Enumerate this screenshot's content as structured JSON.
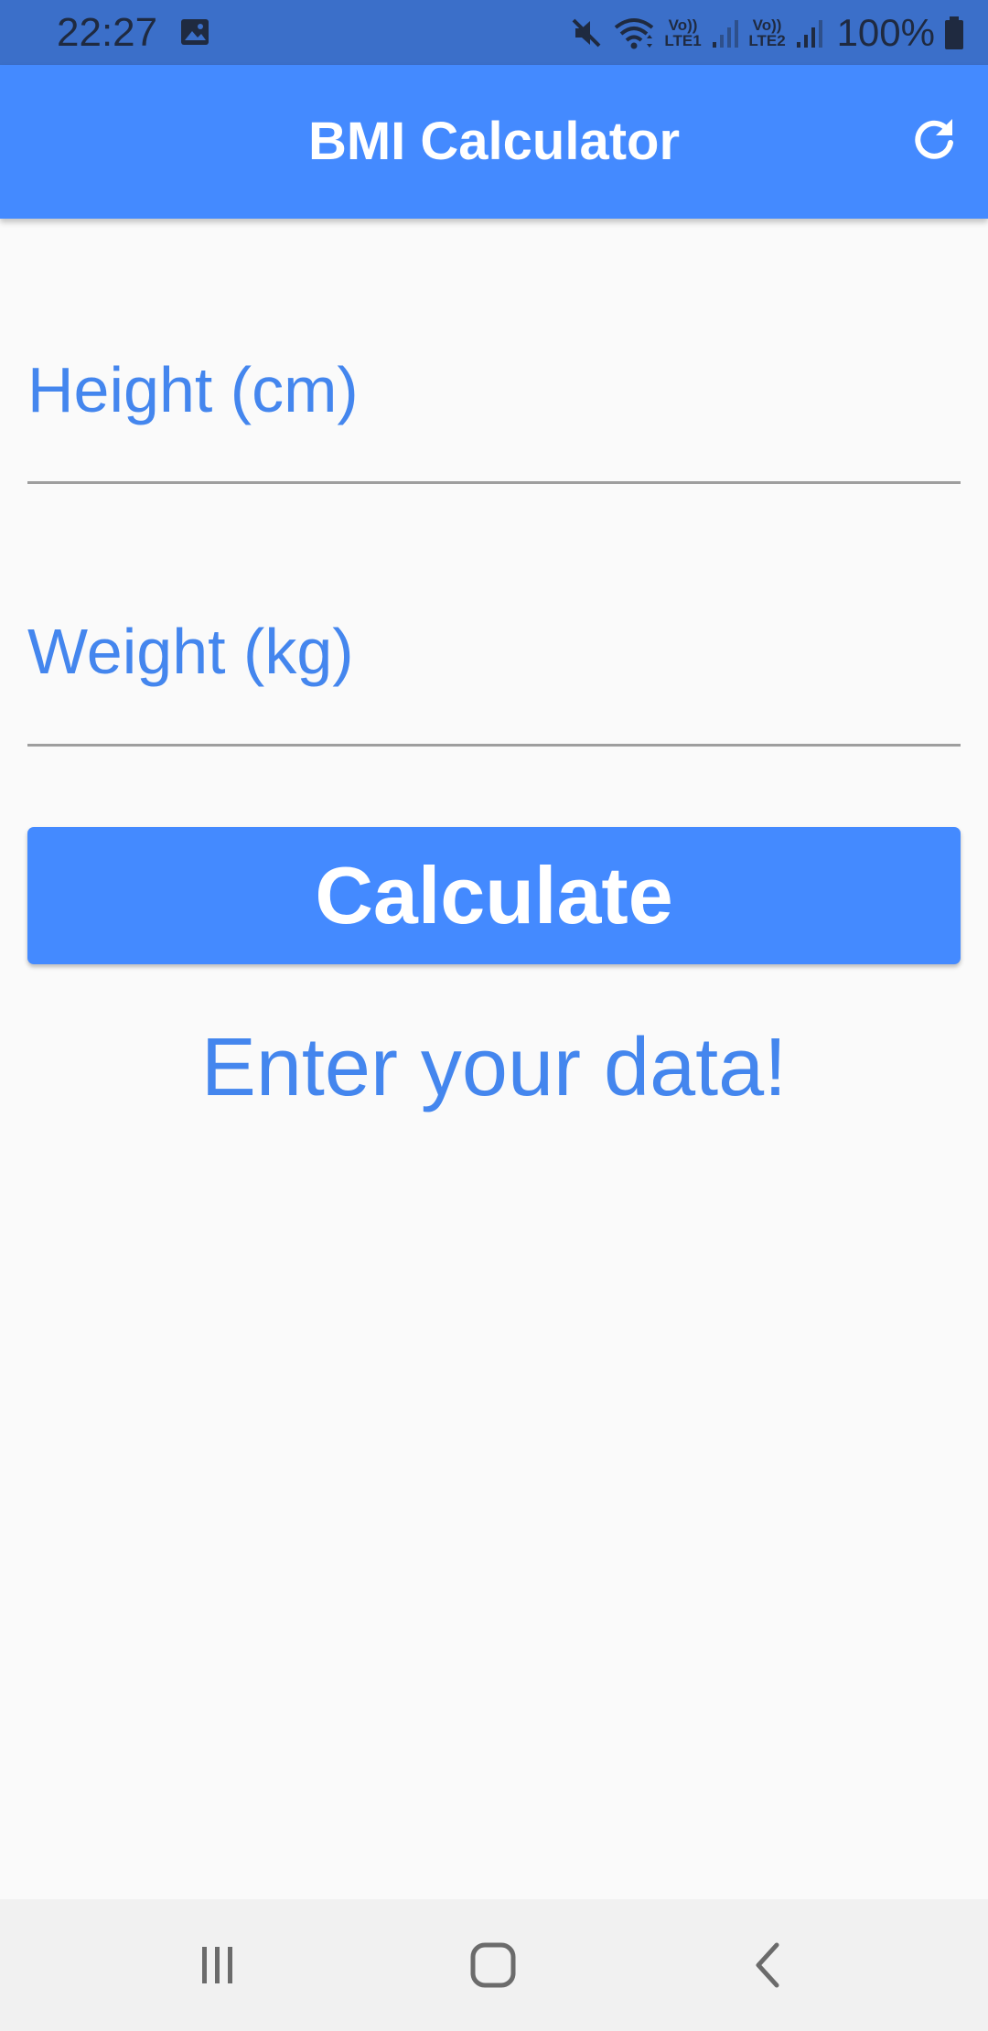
{
  "status_bar": {
    "time": "22:27",
    "sim1_label_top": "Vo))",
    "sim1_label_bottom": "LTE1",
    "sim2_label_top": "Vo))",
    "sim2_label_bottom": "LTE2",
    "battery_text": "100%",
    "icons": [
      "gallery-icon",
      "mute-icon",
      "wifi-icon",
      "signal-icon",
      "signal-icon",
      "battery-icon"
    ]
  },
  "app_bar": {
    "title": "BMI Calculator",
    "action_icon": "refresh-icon"
  },
  "form": {
    "height": {
      "value": "",
      "placeholder": "Height (cm)"
    },
    "weight": {
      "value": "",
      "placeholder": "Weight (kg)"
    },
    "calculate_label": "Calculate",
    "result_text": "Enter your data!"
  },
  "nav_bar": {
    "icons": [
      "recent-apps-icon",
      "home-icon",
      "back-icon"
    ]
  },
  "colors": {
    "status_bar": "#3b6fc9",
    "primary": "#448aff",
    "text_accent": "#4486ee",
    "background": "#fafafa",
    "nav_bar": "#f1f1f1"
  }
}
